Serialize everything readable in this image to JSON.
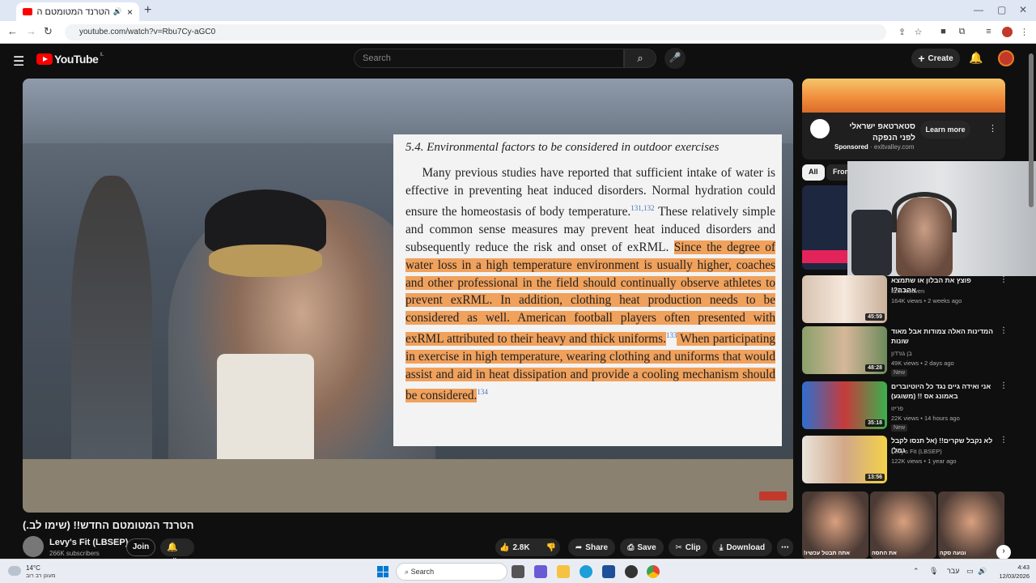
{
  "browser": {
    "tab_title": "הטרנד המטומטם החדש!! (",
    "url": "youtube.com/watch?v=Rbu7Cy-aGC0"
  },
  "header": {
    "brand": "YouTube",
    "region": "IL",
    "search_placeholder": "Search",
    "create_label": "Create"
  },
  "video": {
    "slide_heading": "5.4.  Environmental factors to be considered in outdoor exercises",
    "slide_body_plain": "Many previous studies have reported that sufficient intake of water is effective in preventing heat induced disorders. Normal hydration could ensure the homeostasis of body temperature.",
    "ref1": "131,132",
    "slide_body_plain2": " These relatively simple and common sense measures may prevent heat induced disorders and subsequently reduce the risk and onset of exRML. ",
    "slide_highlight1": "Since the degree of water loss in a high temperature environment is usually higher, coaches and other professional in the field should continually observe athletes to prevent exRML. In addition, clothing heat production needs to be considered as well. American football players often presented with exRML attributed to their heavy and thick uniforms.",
    "ref2": "133",
    "slide_highlight2": " When participating in exercise in high temperature, wearing clothing and uniforms that would assist and aid in heat dissipation and provide a cooling mechanism should be considered.",
    "ref3": "134",
    "title": "הטרנד המטומטם החדש!! (שימו לב.)"
  },
  "channel": {
    "name": "Levy's Fit (LBSEP)",
    "subscribers": "266K subscribers",
    "join_label": "Join"
  },
  "actions": {
    "likes": "2.8K",
    "share": "Share",
    "save": "Save",
    "clip": "Clip",
    "download": "Download"
  },
  "ad": {
    "title": "סטארטאפ ישראלי לפני הנפקה",
    "sponsored": "Sponsored",
    "domain": "exitvalley.com",
    "cta": "Learn more"
  },
  "chips": [
    "All",
    "From"
  ],
  "recommendations": [
    {
      "title": "פוצץ את הבלון או שתמצא אהבה?!",
      "channel": "Itzik Reuven",
      "meta": "164K views • 2 weeks ago",
      "duration": "45:59",
      "badge": ""
    },
    {
      "title": "המדינות האלה צמודות אבל מאוד שונות",
      "channel": "בן גורדון",
      "meta": "49K views • 2 days ago",
      "duration": "48:28",
      "badge": "New"
    },
    {
      "title": "אני ואידה גיים נגד כל היוטיוברים באמונג אס !! (משוגע)",
      "channel": "פריזו",
      "meta": "22K views • 14 hours ago",
      "duration": "35:18",
      "badge": "New"
    },
    {
      "title": "לא נקבל שקרים!! (אל תנסו לקבל גמל)",
      "channel": "Levy's Fit (LBSEP)",
      "meta": "122K views • 1 year ago",
      "duration": "13:56",
      "badge": ""
    }
  ],
  "shorts": [
    "אתה תבטל עכשיו!",
    "את החסה",
    "ונועה סקה"
  ],
  "taskbar": {
    "temp": "14°C",
    "condition": "מעונן רב רוב",
    "search": "Search",
    "lang": "עבר",
    "time": "4:43",
    "date": "12/03/2026"
  },
  "colors": {
    "youtube_red": "#ff0000",
    "highlight": "#f0a15c",
    "bg": "#0f0f0f"
  }
}
